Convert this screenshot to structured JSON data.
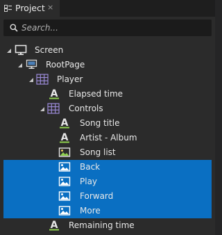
{
  "panel": {
    "tab_label": "Project",
    "close_glyph": "×"
  },
  "search": {
    "placeholder": "Search..."
  },
  "tree": {
    "screen": "Screen",
    "root_page": "RootPage",
    "player": "Player",
    "elapsed_time": "Elapsed time",
    "controls": "Controls",
    "song_title": "Song title",
    "artist_album": "Artist - Album",
    "song_list": "Song list",
    "back": "Back",
    "play": "Play",
    "forward": "Forward",
    "more": "More",
    "remaining_time": "Remaining time"
  },
  "colors": {
    "panel_bg": "#2b2b2b",
    "selection": "#0a6fc2",
    "text": "#e8e8e8",
    "text_icon_green": "#8fd14f",
    "grid_icon_purple": "#9b8ad8"
  },
  "icons": {
    "screen": "monitor-icon",
    "page": "page-icon",
    "grid": "grid-icon",
    "text": "text-icon",
    "image": "image-icon",
    "expanded": "caret-expanded-icon"
  }
}
